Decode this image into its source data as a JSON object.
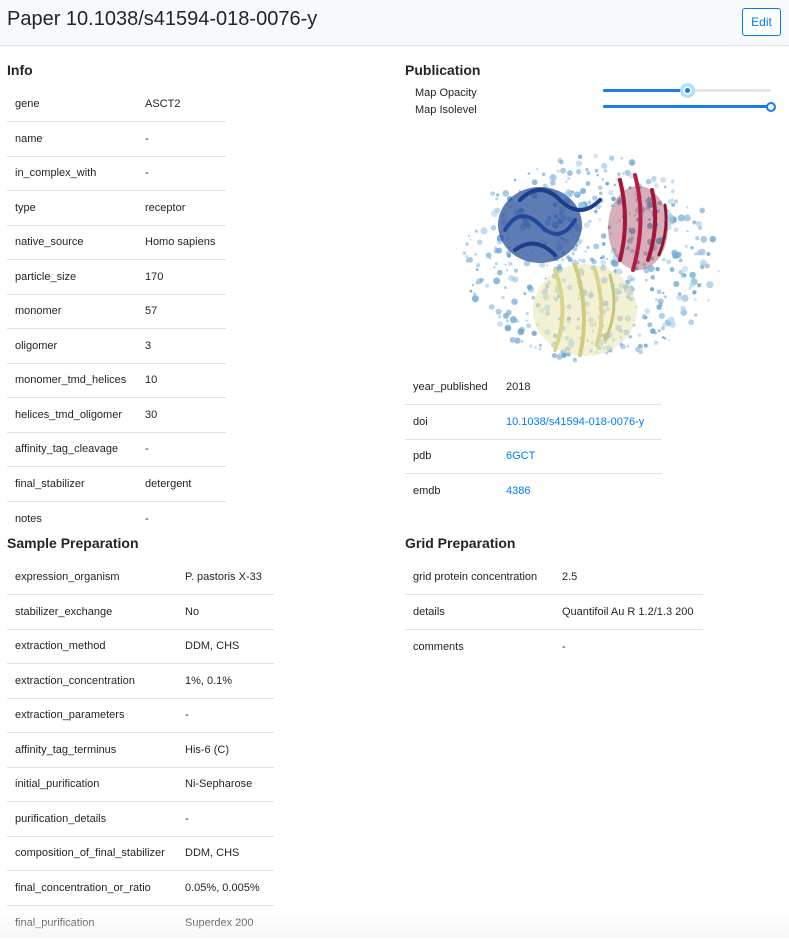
{
  "header": {
    "title": "Paper 10.1038/s41594-018-0076-y",
    "edit_label": "Edit"
  },
  "info": {
    "title": "Info",
    "rows": [
      {
        "key": "gene",
        "value": "ASCT2"
      },
      {
        "key": "name",
        "value": "-"
      },
      {
        "key": "in_complex_with",
        "value": "-"
      },
      {
        "key": "type",
        "value": "receptor"
      },
      {
        "key": "native_source",
        "value": "Homo sapiens"
      },
      {
        "key": "particle_size",
        "value": "170"
      },
      {
        "key": "monomer",
        "value": "57"
      },
      {
        "key": "oligomer",
        "value": "3"
      },
      {
        "key": "monomer_tmd_helices",
        "value": "10"
      },
      {
        "key": "helices_tmd_oligomer",
        "value": "30"
      },
      {
        "key": "affinity_tag_cleavage",
        "value": "-"
      },
      {
        "key": "final_stabilizer",
        "value": "detergent"
      },
      {
        "key": "notes",
        "value": "-"
      }
    ]
  },
  "publication": {
    "title": "Publication",
    "map_opacity_label": "Map Opacity",
    "map_isolevel_label": "Map Isolevel",
    "map_opacity_value": 0.5,
    "map_isolevel_value": 1.0,
    "rows": [
      {
        "key": "year_published",
        "value": "2018",
        "link": false
      },
      {
        "key": "doi",
        "value": "10.1038/s41594-018-0076-y",
        "link": true
      },
      {
        "key": "pdb",
        "value": "6GCT",
        "link": true
      },
      {
        "key": "emdb",
        "value": "4386",
        "link": true
      }
    ]
  },
  "sample_preparation": {
    "title": "Sample Preparation",
    "rows": [
      {
        "key": "expression_organism",
        "value": "P. pastoris X-33"
      },
      {
        "key": "stabilizer_exchange",
        "value": "No"
      },
      {
        "key": "extraction_method",
        "value": "DDM, CHS"
      },
      {
        "key": "extraction_concentration",
        "value": "1%, 0.1%"
      },
      {
        "key": "extraction_parameters",
        "value": "-"
      },
      {
        "key": "affinity_tag_terminus",
        "value": "His-6 (C)"
      },
      {
        "key": "initial_purification",
        "value": "Ni-Sepharose"
      },
      {
        "key": "purification_details",
        "value": "-"
      },
      {
        "key": "composition_of_final_stabilizer",
        "value": "DDM, CHS"
      },
      {
        "key": "final_concentration_or_ratio",
        "value": "0.05%, 0.005%"
      },
      {
        "key": "final_purification",
        "value": "Superdex 200"
      }
    ]
  },
  "grid_preparation": {
    "title": "Grid Preparation",
    "rows": [
      {
        "key": "grid protein concentration",
        "value": "2.5"
      },
      {
        "key": "details",
        "value": "Quantifoil Au R 1.2/1.3 200"
      },
      {
        "key": "comments",
        "value": "-"
      }
    ]
  },
  "colors": {
    "accent": "#007bff",
    "border": "#dee2e6",
    "slider": "#1a7ae8"
  }
}
